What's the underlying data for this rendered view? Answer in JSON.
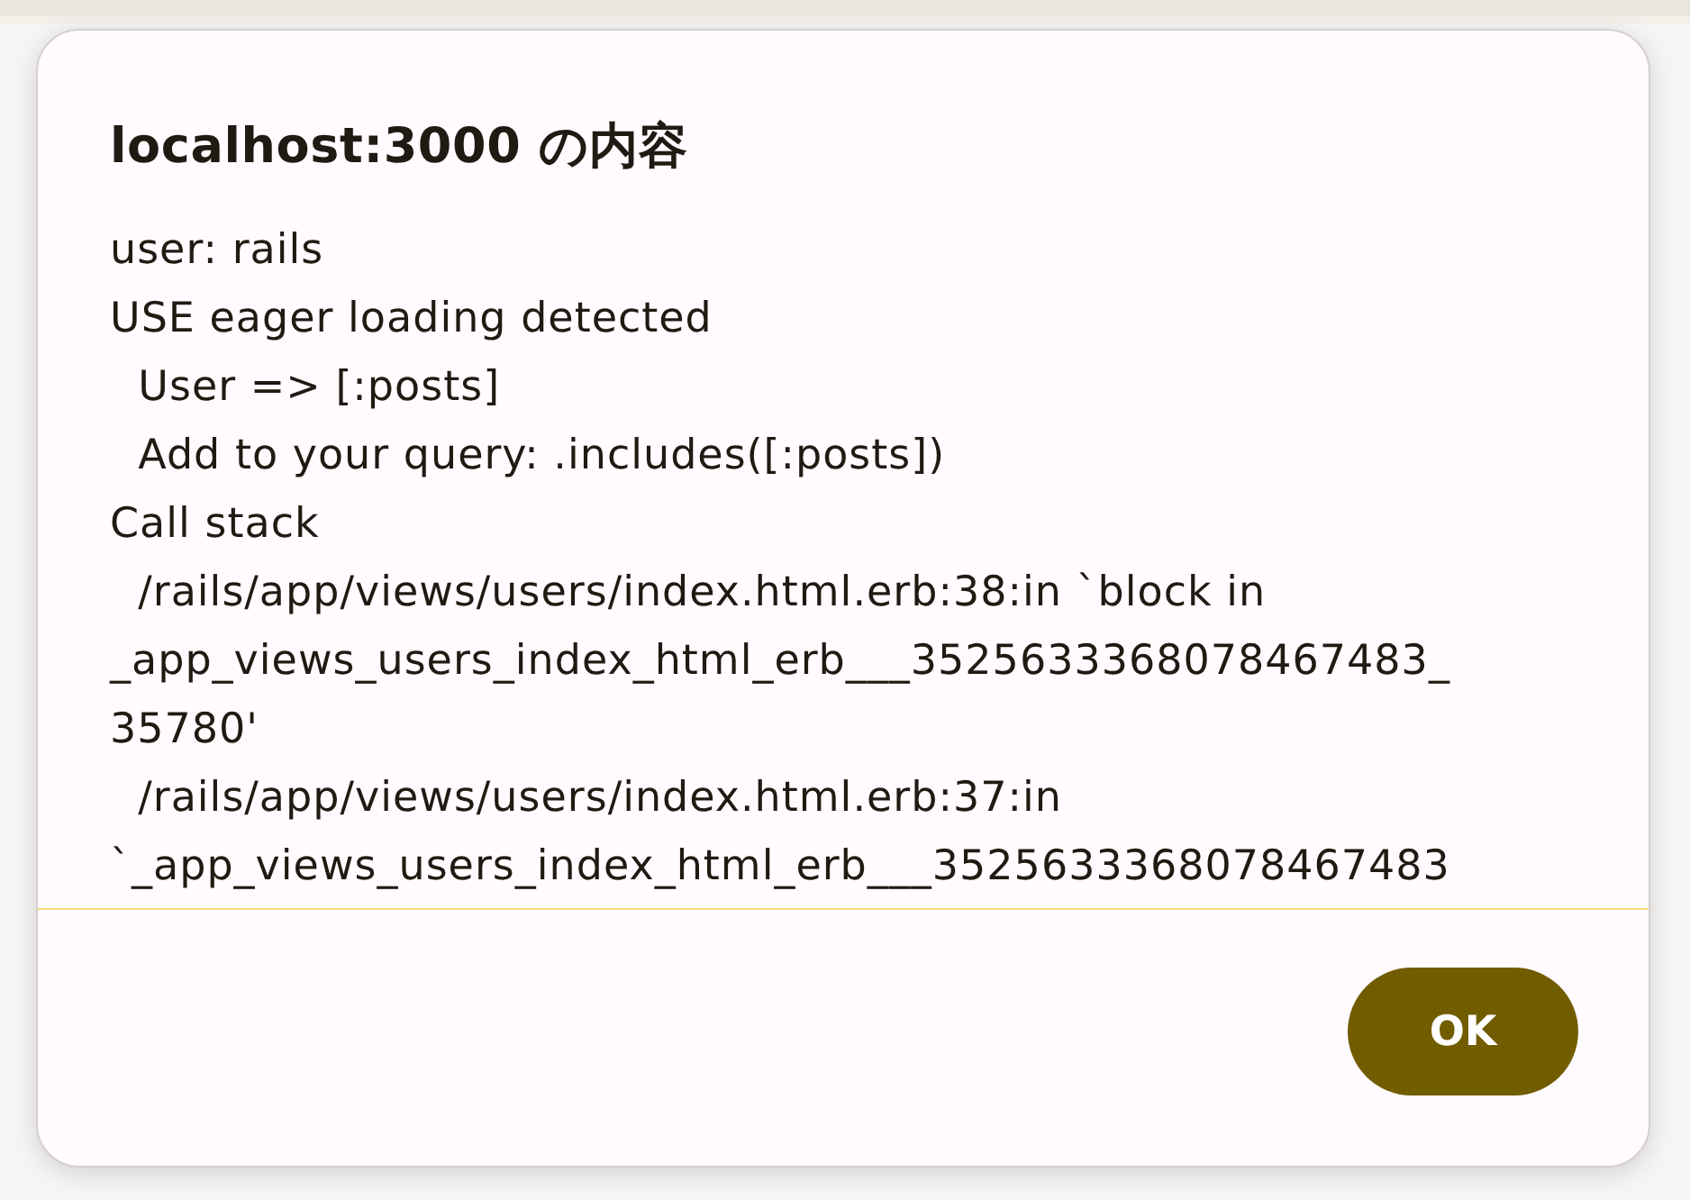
{
  "dialog": {
    "title": "localhost:3000 の内容",
    "message_lines": [
      "user: rails",
      "USE eager loading detected",
      "  User => [:posts]",
      "  Add to your query: .includes([:posts])",
      "Call stack",
      "  /rails/app/views/users/index.html.erb:38:in `block in",
      "_app_views_users_index_html_erb___3525633368078467483_",
      "35780'",
      "  /rails/app/views/users/index.html.erb:37:in",
      "`_app_views_users_index_html_erb___3525633368078467483"
    ],
    "buttons": [
      {
        "label": "OK"
      }
    ]
  }
}
